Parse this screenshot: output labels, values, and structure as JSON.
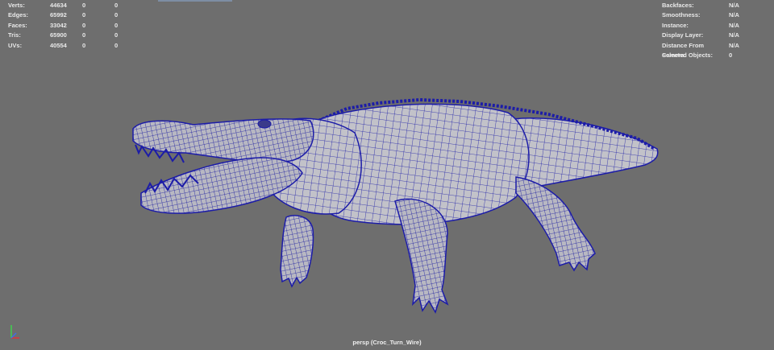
{
  "hud_left": {
    "rows": [
      {
        "label": "Verts:",
        "v1": "44634",
        "v2": "0",
        "v3": "0"
      },
      {
        "label": "Edges:",
        "v1": "65992",
        "v2": "0",
        "v3": "0"
      },
      {
        "label": "Faces:",
        "v1": "33042",
        "v2": "0",
        "v3": "0"
      },
      {
        "label": "Tris:",
        "v1": "65900",
        "v2": "0",
        "v3": "0"
      },
      {
        "label": "UVs:",
        "v1": "40554",
        "v2": "0",
        "v3": "0"
      }
    ]
  },
  "hud_right": {
    "rows": [
      {
        "label": "Backfaces:",
        "value": "N/A"
      },
      {
        "label": "Smoothness:",
        "value": "N/A"
      },
      {
        "label": "Instance:",
        "value": "N/A"
      },
      {
        "label": "Display Layer:",
        "value": "N/A"
      },
      {
        "label": "Distance From Camera:",
        "value": "N/A"
      },
      {
        "label": "Selected Objects:",
        "value": "0"
      }
    ]
  },
  "viewport": {
    "camera_label": "persp (Croc_Turn_Wire)",
    "background_color": "#6e6e6e",
    "wire_color": "#1c1ca8",
    "shade_color": "#bdbdc4"
  },
  "icons": {
    "axis": "axis-gizmo-icon",
    "model": "crocodile-wireframe-mesh"
  }
}
